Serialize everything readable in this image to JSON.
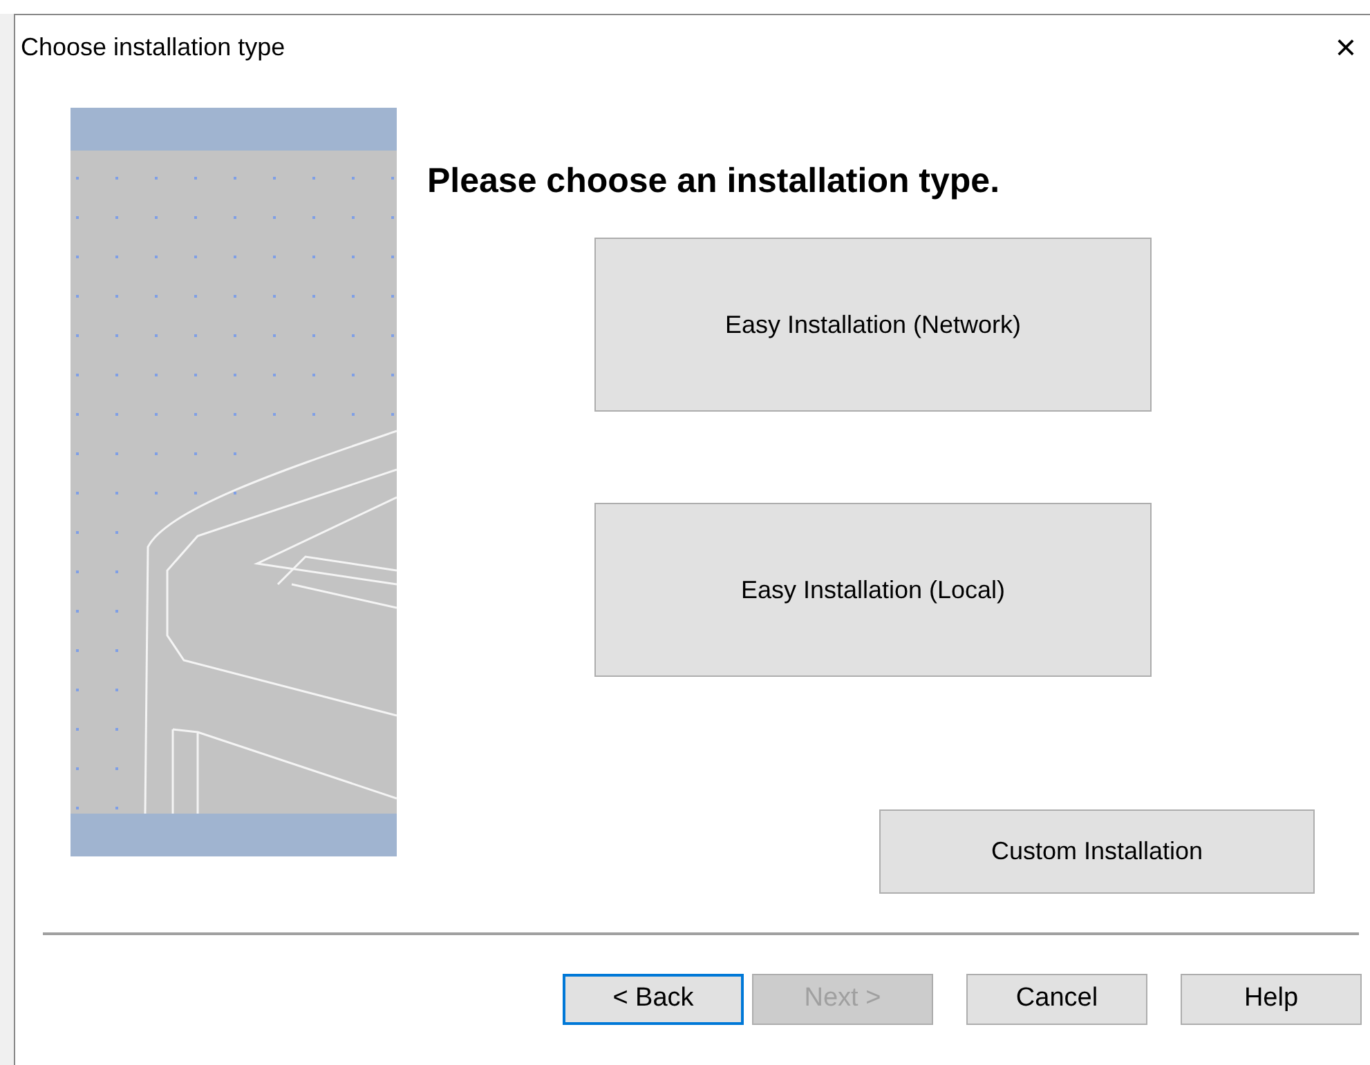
{
  "window": {
    "title": "Choose installation type",
    "close": "×"
  },
  "heading": "Please choose an installation type.",
  "options": [
    {
      "label": "Easy Installation (Network)"
    },
    {
      "label": "Easy Installation (Local)"
    }
  ],
  "custom_button": "Custom Installation",
  "nav_buttons": [
    {
      "label": "< Back",
      "disabled": false,
      "focused": true
    },
    {
      "label": "Next >",
      "disabled": true,
      "focused": false
    },
    {
      "label": "Cancel",
      "disabled": false,
      "focused": false
    },
    {
      "label": "Help",
      "disabled": false,
      "focused": false
    }
  ]
}
